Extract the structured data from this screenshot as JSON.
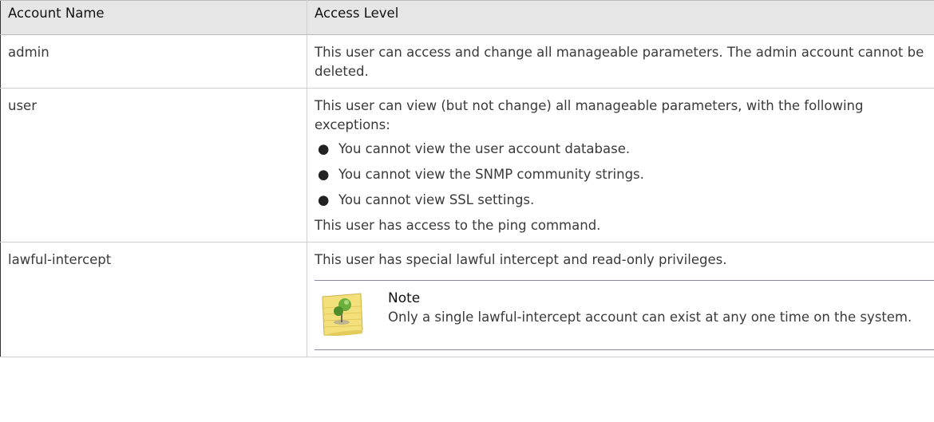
{
  "table": {
    "headers": [
      "Account Name",
      "Access Level"
    ],
    "rows": [
      {
        "name": "admin",
        "description": "This user can access and change all manageable parameters. The admin account cannot be deleted."
      },
      {
        "name": "user",
        "description": "This user can view (but not change) all manageable parameters, with the following exceptions:",
        "bullets": [
          "You cannot view the user account database.",
          "You cannot view the SNMP community strings.",
          "You cannot view SSL settings."
        ],
        "after": "This user has access to the ping command."
      },
      {
        "name": "lawful-intercept",
        "description": "This user has special lawful intercept and read-only privileges.",
        "note": {
          "heading": "Note",
          "body": "Only a single lawful-intercept account can exist at any one time on the system.",
          "icon": "sticky-note-pin-icon"
        }
      }
    ]
  },
  "colors": {
    "header_bg": "#e6e6e6",
    "border": "#cfcfcf",
    "note_rule": "#8a8a9e",
    "note_yellow": "#f3e07a",
    "pin_green": "#6cae3e"
  }
}
